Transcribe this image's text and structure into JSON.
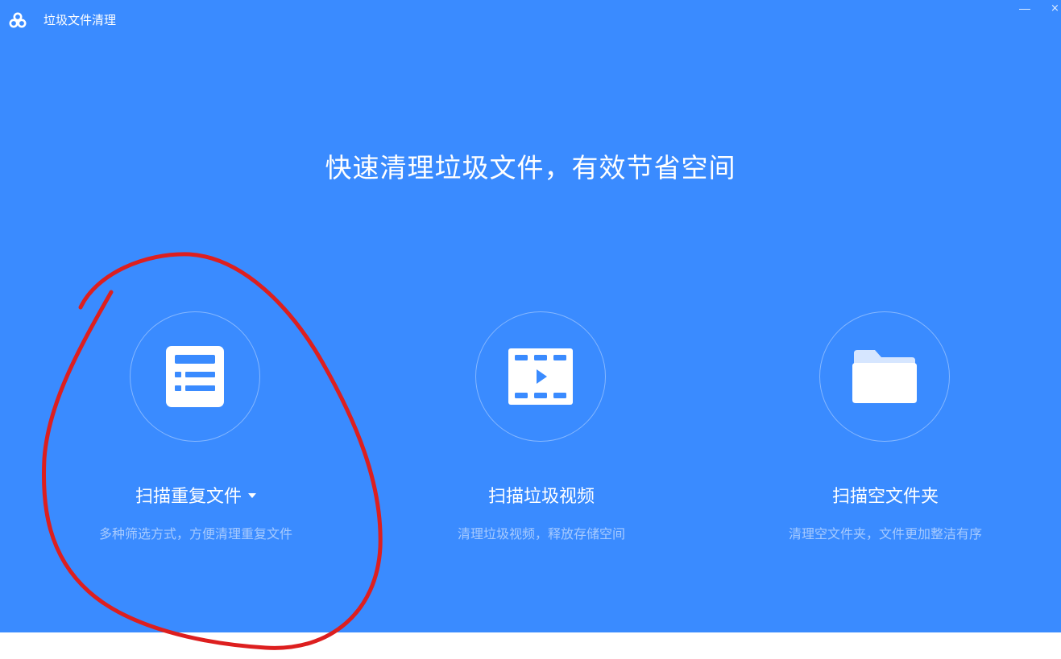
{
  "window": {
    "title": "垃圾文件清理",
    "minimize_glyph": "—",
    "close_glyph": "×"
  },
  "headline": "快速清理垃圾文件，有效节省空间",
  "options": [
    {
      "icon": "duplicate-list-icon",
      "label": "扫描重复文件",
      "desc": "多种筛选方式，方便清理重复文件",
      "has_dropdown": true
    },
    {
      "icon": "video-icon",
      "label": "扫描垃圾视频",
      "desc": "清理垃圾视频，释放存储空间"
    },
    {
      "icon": "folder-icon",
      "label": "扫描空文件夹",
      "desc": "清理空文件夹，文件更加整洁有序"
    }
  ],
  "colors": {
    "background": "#3a8bff",
    "annotation": "#dd1f1f"
  }
}
